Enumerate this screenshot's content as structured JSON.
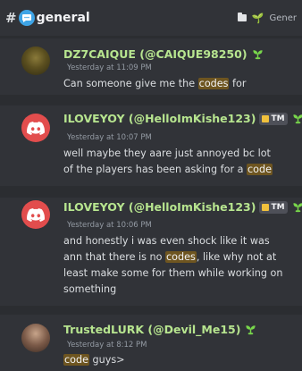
{
  "header": {
    "hash": "#",
    "channel": "general",
    "right_label": "Gener"
  },
  "messages": [
    {
      "author": "DZ7CAIQUE (@CAIQUE98250)",
      "timestamp": "Yesterday at 11:09 PM",
      "lines": [
        [
          {
            "t": "Can someone give me the "
          },
          {
            "t": "codes",
            "hl": true
          },
          {
            "t": " for"
          }
        ]
      ]
    },
    {
      "author": "ILOVEYOY (@HelloImKishe123)",
      "tag": "TM",
      "timestamp": "Yesterday at 10:07 PM",
      "lines": [
        [
          {
            "t": "well maybe they aare just annoyed bc lot"
          }
        ],
        [
          {
            "t": "of the players has been asking for a "
          },
          {
            "t": "code",
            "hl": true
          }
        ]
      ]
    },
    {
      "author": "ILOVEYOY (@HelloImKishe123)",
      "tag": "TM",
      "timestamp": "Yesterday at 10:06 PM",
      "lines": [
        [
          {
            "t": "and honestly i was even shock like it was"
          }
        ],
        [
          {
            "t": "ann that there is no "
          },
          {
            "t": "codes",
            "hl": true
          },
          {
            "t": ", like why not at"
          }
        ],
        [
          {
            "t": "least make some for them while working on"
          }
        ],
        [
          {
            "t": "something"
          }
        ]
      ]
    },
    {
      "author": "TrustedLURK (@Devil_Me15)",
      "timestamp": "Yesterday at 8:12 PM",
      "lines": [
        [
          {
            "t": "code",
            "hl": true
          },
          {
            "t": " guys>"
          }
        ]
      ]
    }
  ]
}
